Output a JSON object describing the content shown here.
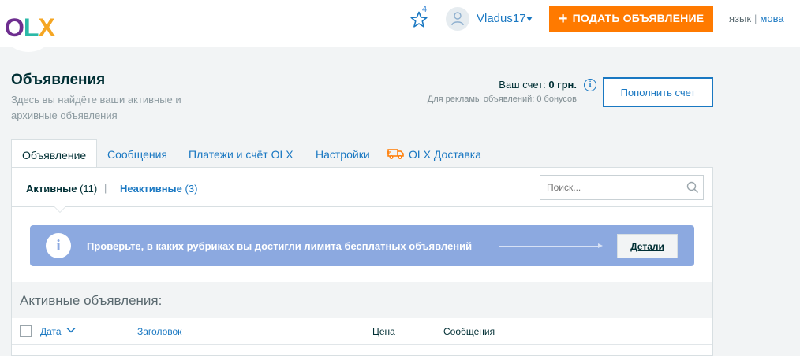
{
  "header": {
    "logo": {
      "o": "O",
      "l": "L",
      "x": "X"
    },
    "favorites_count": "4",
    "username": "Vladus17",
    "post_button_label": "ПОДАТЬ ОБЪЯВЛЕНИЕ",
    "lang_ru": "язык",
    "lang_ua": "мова"
  },
  "page": {
    "title": "Объявления",
    "subtitle": "Здесь вы найдёте ваши активные и архивные объявления"
  },
  "account": {
    "balance_label": "Ваш счет: ",
    "balance_value": "0 грн.",
    "bonus_text": "Для рекламы объявлений: 0 бонусов",
    "topup_label": "Пополнить счет"
  },
  "tabs": [
    {
      "label": "Объявление"
    },
    {
      "label": "Сообщения"
    },
    {
      "label": "Платежи и счёт OLX"
    },
    {
      "label": "Настройки"
    },
    {
      "label": "OLX Доставка"
    }
  ],
  "subtabs": {
    "active_label": "Активные",
    "active_count": "(11)",
    "separator": "|",
    "inactive_label": "Неактивные",
    "inactive_count": "(3)"
  },
  "search": {
    "placeholder": "Поиск..."
  },
  "notice": {
    "text": "Проверьте, в каких рубриках вы достигли лимита бесплатных объявлений",
    "details_label": "Детали"
  },
  "list": {
    "section_title": "Активные объявления:",
    "columns": {
      "date": "Дата",
      "title": "Заголовок",
      "price": "Цена",
      "messages": "Сообщения"
    }
  },
  "colors": {
    "accent_orange": "#ff7a00",
    "link_blue": "#1a78c2",
    "notice_blue": "#8ca9e0",
    "page_bg": "#f2f4f5"
  },
  "icons": [
    "star-icon",
    "user-icon",
    "plus-icon",
    "info-icon",
    "truck-icon",
    "search-icon",
    "chevron-down-icon"
  ]
}
